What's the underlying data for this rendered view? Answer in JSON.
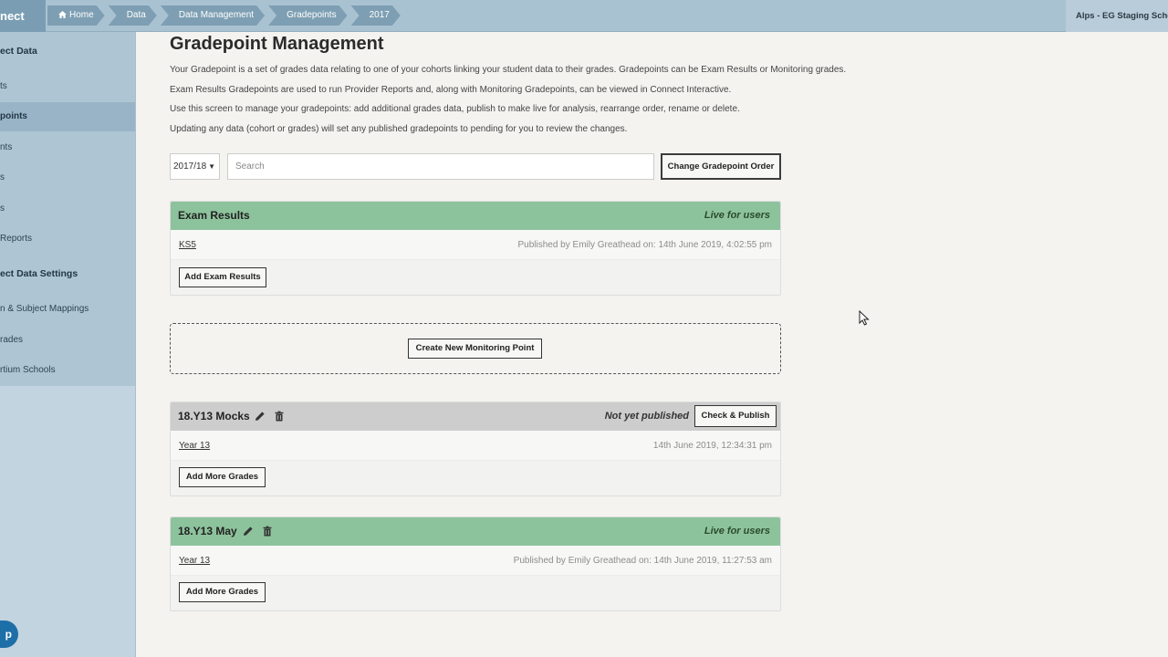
{
  "topbar": {
    "brand": "nect",
    "breadcrumbs": [
      "Home",
      "Data",
      "Data Management",
      "Gradepoints",
      "2017"
    ],
    "school": "Alps - EG Staging School"
  },
  "sidebar": {
    "items": [
      {
        "label": "ect Data",
        "type": "head"
      },
      {
        "label": "ts",
        "type": "item"
      },
      {
        "label": "points",
        "type": "active"
      },
      {
        "label": "nts",
        "type": "item"
      },
      {
        "label": "s",
        "type": "item"
      },
      {
        "label": "s",
        "type": "item"
      },
      {
        "label": "Reports",
        "type": "item"
      },
      {
        "label": "ect Data Settings",
        "type": "head"
      },
      {
        "label": "n & Subject Mappings",
        "type": "item"
      },
      {
        "label": "rades",
        "type": "item"
      },
      {
        "label": "rtium Schools",
        "type": "item"
      }
    ],
    "help_label": "p"
  },
  "main": {
    "title": "Gradepoint Management",
    "paragraphs": [
      "Your Gradepoint is a set of grades data relating to one of your cohorts linking your student data to their grades. Gradepoints can be Exam Results or Monitoring grades.",
      "Exam Results Gradepoints are used to run Provider Reports and, along with Monitoring Gradepoints, can be viewed in Connect Interactive.",
      "Use this screen to manage your gradepoints: add additional grades data, publish to make live for analysis, rearrange order, rename or delete.",
      "Updating any data (cohort or grades) will set any published gradepoints to pending for you to review the changes."
    ],
    "year": "2017/18",
    "search_placeholder": "Search",
    "change_order_label": "Change Gradepoint Order",
    "create_monitoring_label": "Create New Monitoring Point"
  },
  "cards": [
    {
      "title": "Exam Results",
      "status": "Live for users",
      "link": "KS5",
      "meta": "Published by Emily Greathead on: 14th June 2019, 4:02:55 pm",
      "button": "Add Exam Results"
    },
    {
      "title": "18.Y13 Mocks",
      "status": "Not yet published",
      "publish_label": "Check & Publish",
      "link": "Year 13",
      "meta": "14th June 2019, 12:34:31 pm",
      "button": "Add More Grades"
    },
    {
      "title": "18.Y13 May",
      "status": "Live for users",
      "link": "Year 13",
      "meta": "Published by Emily Greathead on: 14th June 2019, 11:27:53 am",
      "button": "Add More Grades"
    }
  ],
  "colors": {
    "live_header": "#8dc39c",
    "unpublished_header": "#cdcdcd",
    "sidebar": "#c2d4df",
    "breadcrumb": "#7e9fb3"
  }
}
